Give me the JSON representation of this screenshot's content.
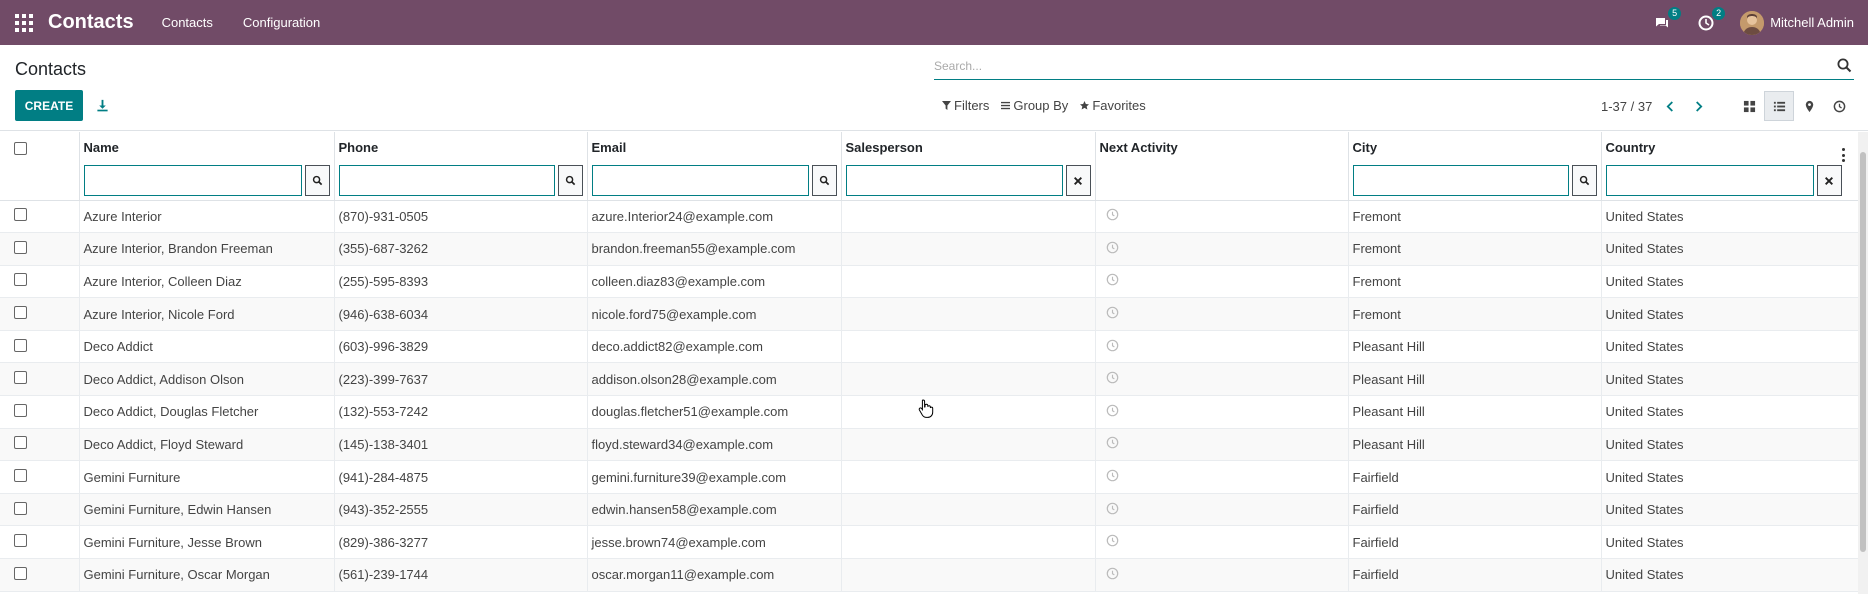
{
  "navbar": {
    "app_title": "Contacts",
    "menu": [
      "Contacts",
      "Configuration"
    ],
    "messages_count": "5",
    "activities_count": "2",
    "user_name": "Mitchell Admin"
  },
  "control_panel": {
    "breadcrumb": "Contacts",
    "create_label": "CREATE",
    "search_placeholder": "Search...",
    "filters_label": "Filters",
    "groupby_label": "Group By",
    "favorites_label": "Favorites",
    "pager": "1-37 / 37"
  },
  "columns": [
    "Name",
    "Phone",
    "Email",
    "Salesperson",
    "Next Activity",
    "City",
    "Country"
  ],
  "rows": [
    {
      "name": "Azure Interior",
      "phone": "(870)-931-0505",
      "email": "azure.Interior24@example.com",
      "salesperson": "",
      "city": "Fremont",
      "country": "United States"
    },
    {
      "name": "Azure Interior, Brandon Freeman",
      "phone": "(355)-687-3262",
      "email": "brandon.freeman55@example.com",
      "salesperson": "",
      "city": "Fremont",
      "country": "United States"
    },
    {
      "name": "Azure Interior, Colleen Diaz",
      "phone": "(255)-595-8393",
      "email": "colleen.diaz83@example.com",
      "salesperson": "",
      "city": "Fremont",
      "country": "United States"
    },
    {
      "name": "Azure Interior, Nicole Ford",
      "phone": "(946)-638-6034",
      "email": "nicole.ford75@example.com",
      "salesperson": "",
      "city": "Fremont",
      "country": "United States"
    },
    {
      "name": "Deco Addict",
      "phone": "(603)-996-3829",
      "email": "deco.addict82@example.com",
      "salesperson": "",
      "city": "Pleasant Hill",
      "country": "United States"
    },
    {
      "name": "Deco Addict, Addison Olson",
      "phone": "(223)-399-7637",
      "email": "addison.olson28@example.com",
      "salesperson": "",
      "city": "Pleasant Hill",
      "country": "United States"
    },
    {
      "name": "Deco Addict, Douglas Fletcher",
      "phone": "(132)-553-7242",
      "email": "douglas.fletcher51@example.com",
      "salesperson": "",
      "city": "Pleasant Hill",
      "country": "United States"
    },
    {
      "name": "Deco Addict, Floyd Steward",
      "phone": "(145)-138-3401",
      "email": "floyd.steward34@example.com",
      "salesperson": "",
      "city": "Pleasant Hill",
      "country": "United States"
    },
    {
      "name": "Gemini Furniture",
      "phone": "(941)-284-4875",
      "email": "gemini.furniture39@example.com",
      "salesperson": "",
      "city": "Fairfield",
      "country": "United States"
    },
    {
      "name": "Gemini Furniture, Edwin Hansen",
      "phone": "(943)-352-2555",
      "email": "edwin.hansen58@example.com",
      "salesperson": "",
      "city": "Fairfield",
      "country": "United States"
    },
    {
      "name": "Gemini Furniture, Jesse Brown",
      "phone": "(829)-386-3277",
      "email": "jesse.brown74@example.com",
      "salesperson": "",
      "city": "Fairfield",
      "country": "United States"
    },
    {
      "name": "Gemini Furniture, Oscar Morgan",
      "phone": "(561)-239-1744",
      "email": "oscar.morgan11@example.com",
      "salesperson": "",
      "city": "Fairfield",
      "country": "United States"
    }
  ],
  "colors": {
    "navbar": "#714b67",
    "primary": "#017e84"
  }
}
